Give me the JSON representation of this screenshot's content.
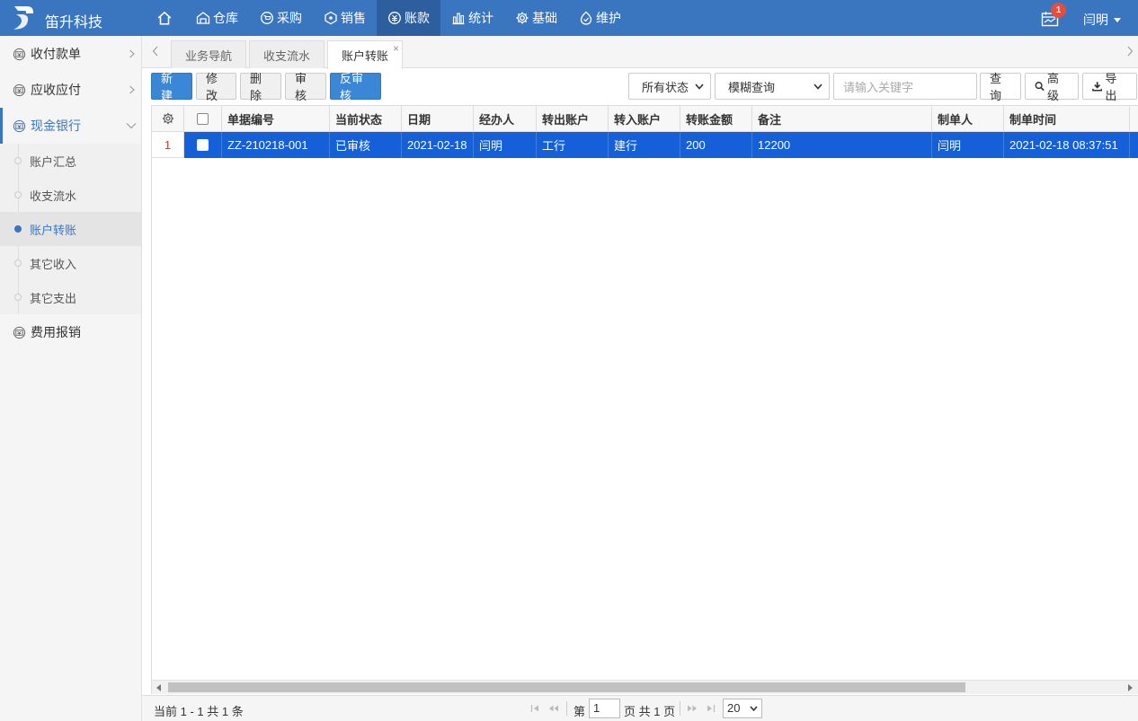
{
  "app": {
    "brand": "笛升科技"
  },
  "nav": {
    "items": [
      {
        "label": "仓库",
        "icon": "warehouse-icon"
      },
      {
        "label": "采购",
        "icon": "cart-icon"
      },
      {
        "label": "销售",
        "icon": "tag-icon"
      },
      {
        "label": "账款",
        "icon": "coin-icon",
        "active": true
      },
      {
        "label": "统计",
        "icon": "bar-chart-icon"
      },
      {
        "label": "基础",
        "icon": "gear-icon"
      },
      {
        "label": "维护",
        "icon": "maintenance-icon"
      }
    ],
    "notification_count": "1",
    "user_name": "闫明"
  },
  "sidebar": {
    "menus": [
      {
        "label": "收付款单"
      },
      {
        "label": "应收应付"
      },
      {
        "label": "现金银行",
        "active": true
      },
      {
        "label": "费用报销"
      }
    ],
    "sub_items": [
      {
        "label": "账户汇总"
      },
      {
        "label": "收支流水"
      },
      {
        "label": "账户转账",
        "active": true
      },
      {
        "label": "其它收入"
      },
      {
        "label": "其它支出"
      }
    ]
  },
  "tabs": [
    {
      "label": "业务导航"
    },
    {
      "label": "收支流水"
    },
    {
      "label": "账户转账",
      "active": true,
      "close": "×"
    }
  ],
  "toolbar": {
    "new_label": "新建",
    "edit_label": "修改",
    "delete_label": "删除",
    "audit_label": "审核",
    "unaudit_label": "反审核",
    "status_select": "所有状态",
    "query_mode_select": "模糊查询",
    "keyword_placeholder": "请输入关键字",
    "query_label": "查询",
    "advanced_label": "高级",
    "export_label": "导出"
  },
  "table": {
    "columns": [
      "单据编号",
      "当前状态",
      "日期",
      "经办人",
      "转出账户",
      "转入账户",
      "转账金额",
      "备注",
      "制单人",
      "制单时间"
    ],
    "rows": [
      {
        "row_number": "1",
        "cells": [
          "ZZ-210218-001",
          "已审核",
          "2021-02-18",
          "闫明",
          "工行",
          "建行",
          "200",
          "12200",
          "闫明",
          "2021-02-18 08:37:51"
        ]
      }
    ]
  },
  "pager": {
    "info": "当前 1 - 1 共 1 条",
    "page_prefix": "第",
    "page_value": "1",
    "page_suffix": "页 共 1 页",
    "page_size": "20"
  },
  "colors": {
    "header_bg": "#3a76c0",
    "nav_active_bg": "#2d5f9e",
    "accent": "#3a76c0",
    "primary_button": "#3a87d7",
    "selected_row": "#1560d8",
    "badge": "#e74c3c"
  }
}
